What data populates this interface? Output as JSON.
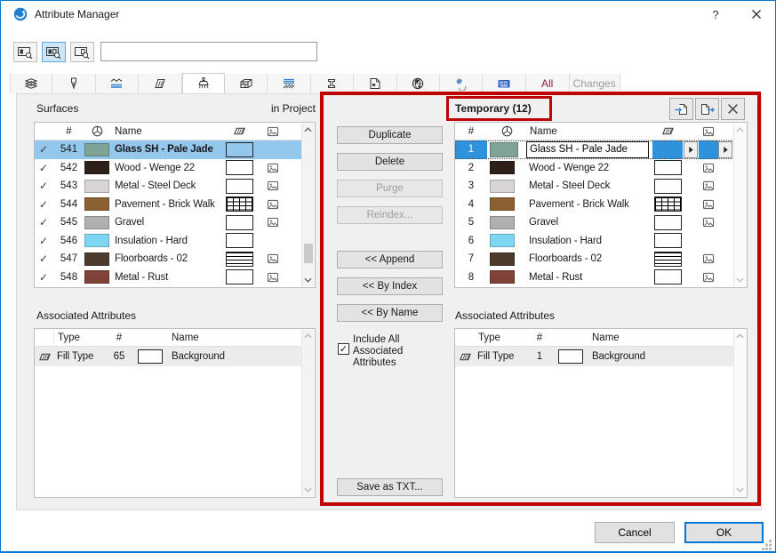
{
  "window": {
    "title": "Attribute Manager",
    "help_label": "?"
  },
  "toolbar": {
    "search_value": "",
    "filter_buttons": [
      "find-by-index",
      "find-by-index-and-name",
      "find-by-name"
    ]
  },
  "tabs": {
    "icons": [
      "layers",
      "pens",
      "line-types",
      "fills",
      "surfaces",
      "composites",
      "building-materials",
      "profiles",
      "zones",
      "cities",
      "operation-profiles",
      "mep-systems"
    ],
    "selected": "surfaces",
    "all_label": "All",
    "changes_label": "Changes"
  },
  "glyphs": {
    "check": "✓"
  },
  "left": {
    "title": "Surfaces",
    "scope": "in Project",
    "table": {
      "col_num": "#",
      "col_name": "Name"
    },
    "rows": [
      {
        "num": "541",
        "swatch": "#7FA396",
        "name": "Glass SH - Pale Jade",
        "fill": "selected-blue",
        "image": false,
        "checked": true,
        "selected": true
      },
      {
        "num": "542",
        "swatch": "#2E2018",
        "name": "Wood - Wenge 22",
        "fill": "plain",
        "image": true,
        "checked": true,
        "selected": false
      },
      {
        "num": "543",
        "swatch": "#D8D4D8",
        "name": "Metal - Steel Deck",
        "fill": "plain",
        "image": true,
        "checked": true,
        "selected": false
      },
      {
        "num": "544",
        "swatch": "#8B6134",
        "name": "Pavement - Brick Walk",
        "fill": "brick",
        "image": true,
        "checked": true,
        "selected": false
      },
      {
        "num": "545",
        "swatch": "#B0B0B0",
        "name": "Gravel",
        "fill": "plain",
        "image": true,
        "checked": true,
        "selected": false
      },
      {
        "num": "546",
        "swatch": "#7DD7F2",
        "name": "Insulation - Hard",
        "fill": "plain",
        "image": false,
        "checked": true,
        "selected": false
      },
      {
        "num": "547",
        "swatch": "#4C3A2D",
        "name": "Floorboards - 02",
        "fill": "lines",
        "image": true,
        "checked": true,
        "selected": false
      },
      {
        "num": "548",
        "swatch": "#7F4238",
        "name": "Metal - Rust",
        "fill": "plain",
        "image": true,
        "checked": true,
        "selected": false
      }
    ],
    "assoc": {
      "title": "Associated Attributes",
      "col_type": "Type",
      "col_num": "#",
      "col_name": "Name",
      "rows": [
        {
          "type": "Fill Type",
          "num": "65",
          "name": "Background"
        }
      ]
    }
  },
  "middle": {
    "duplicate": "Duplicate",
    "delete": "Delete",
    "purge": "Purge",
    "reindex": "Reindex...",
    "append": "<< Append",
    "by_index": "<< By Index",
    "by_name": "<< By Name",
    "include_label": "Include All Associated Attributes",
    "include_checked": true,
    "save_txt": "Save as TXT..."
  },
  "right": {
    "title": "Temporary (12)",
    "header_buttons": [
      "open-file",
      "save-file",
      "clear"
    ],
    "table": {
      "col_num": "#",
      "col_name": "Name"
    },
    "rows": [
      {
        "num": "1",
        "swatch": "#7FA396",
        "name": "Glass SH - Pale Jade",
        "fill": "edit-blue",
        "image": false,
        "editing": true
      },
      {
        "num": "2",
        "swatch": "#2E2018",
        "name": "Wood - Wenge 22",
        "fill": "plain",
        "image": true,
        "editing": false
      },
      {
        "num": "3",
        "swatch": "#D8D4D8",
        "name": "Metal - Steel Deck",
        "fill": "plain",
        "image": true,
        "editing": false
      },
      {
        "num": "4",
        "swatch": "#8B6134",
        "name": "Pavement - Brick Walk",
        "fill": "brick",
        "image": true,
        "editing": false
      },
      {
        "num": "5",
        "swatch": "#B0B0B0",
        "name": "Gravel",
        "fill": "plain",
        "image": true,
        "editing": false
      },
      {
        "num": "6",
        "swatch": "#7DD7F2",
        "name": "Insulation - Hard",
        "fill": "plain",
        "image": false,
        "editing": false
      },
      {
        "num": "7",
        "swatch": "#4C3A2D",
        "name": "Floorboards - 02",
        "fill": "lines",
        "image": true,
        "editing": false
      },
      {
        "num": "8",
        "swatch": "#7F4238",
        "name": "Metal - Rust",
        "fill": "plain",
        "image": true,
        "editing": false
      }
    ],
    "assoc": {
      "title": "Associated Attributes",
      "col_type": "Type",
      "col_num": "#",
      "col_name": "Name",
      "rows": [
        {
          "type": "Fill Type",
          "num": "1",
          "name": "Background"
        }
      ]
    }
  },
  "footer": {
    "cancel": "Cancel",
    "ok": "OK"
  },
  "colors": {
    "accent": "#0078D7",
    "annotation_red": "#BE0202",
    "selection_light": "#94C7EC",
    "selection_strong": "#2E93DC",
    "all_tab_text": "#8B1E3F"
  }
}
